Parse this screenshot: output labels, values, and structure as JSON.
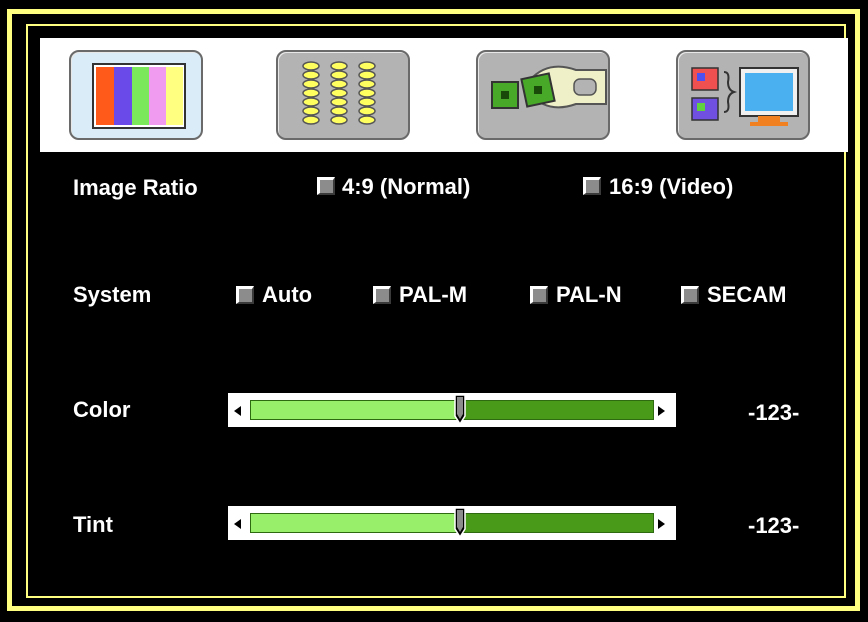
{
  "tabs": [
    {
      "name": "picture",
      "icon": "color-bars-icon",
      "active": true
    },
    {
      "name": "audio",
      "icon": "equalizer-icon",
      "active": false
    },
    {
      "name": "setup",
      "icon": "wrench-chip-icon",
      "active": false
    },
    {
      "name": "input",
      "icon": "input-monitor-icon",
      "active": false
    }
  ],
  "image_ratio": {
    "label": "Image Ratio",
    "options": [
      "4:9 (Normal)",
      "16:9 (Video)"
    ]
  },
  "system": {
    "label": "System",
    "options": [
      "Auto",
      "PAL-M",
      "PAL-N",
      "SECAM"
    ]
  },
  "color": {
    "label": "Color",
    "value_text": "-123-",
    "level": 0.52
  },
  "tint": {
    "label": "Tint",
    "value_text": "-123-",
    "level": 0.52
  },
  "colors": {
    "frame": "#ffff80",
    "slider_fill": "#98f06a",
    "slider_track": "#4a9a1a"
  }
}
